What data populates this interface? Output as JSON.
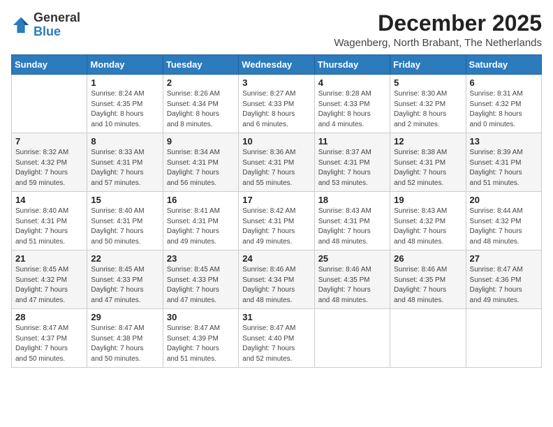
{
  "logo": {
    "general": "General",
    "blue": "Blue"
  },
  "title": "December 2025",
  "subtitle": "Wagenberg, North Brabant, The Netherlands",
  "days_of_week": [
    "Sunday",
    "Monday",
    "Tuesday",
    "Wednesday",
    "Thursday",
    "Friday",
    "Saturday"
  ],
  "weeks": [
    [
      {
        "day": "",
        "info": ""
      },
      {
        "day": "1",
        "info": "Sunrise: 8:24 AM\nSunset: 4:35 PM\nDaylight: 8 hours\nand 10 minutes."
      },
      {
        "day": "2",
        "info": "Sunrise: 8:26 AM\nSunset: 4:34 PM\nDaylight: 8 hours\nand 8 minutes."
      },
      {
        "day": "3",
        "info": "Sunrise: 8:27 AM\nSunset: 4:33 PM\nDaylight: 8 hours\nand 6 minutes."
      },
      {
        "day": "4",
        "info": "Sunrise: 8:28 AM\nSunset: 4:33 PM\nDaylight: 8 hours\nand 4 minutes."
      },
      {
        "day": "5",
        "info": "Sunrise: 8:30 AM\nSunset: 4:32 PM\nDaylight: 8 hours\nand 2 minutes."
      },
      {
        "day": "6",
        "info": "Sunrise: 8:31 AM\nSunset: 4:32 PM\nDaylight: 8 hours\nand 0 minutes."
      }
    ],
    [
      {
        "day": "7",
        "info": "Sunrise: 8:32 AM\nSunset: 4:32 PM\nDaylight: 7 hours\nand 59 minutes."
      },
      {
        "day": "8",
        "info": "Sunrise: 8:33 AM\nSunset: 4:31 PM\nDaylight: 7 hours\nand 57 minutes."
      },
      {
        "day": "9",
        "info": "Sunrise: 8:34 AM\nSunset: 4:31 PM\nDaylight: 7 hours\nand 56 minutes."
      },
      {
        "day": "10",
        "info": "Sunrise: 8:36 AM\nSunset: 4:31 PM\nDaylight: 7 hours\nand 55 minutes."
      },
      {
        "day": "11",
        "info": "Sunrise: 8:37 AM\nSunset: 4:31 PM\nDaylight: 7 hours\nand 53 minutes."
      },
      {
        "day": "12",
        "info": "Sunrise: 8:38 AM\nSunset: 4:31 PM\nDaylight: 7 hours\nand 52 minutes."
      },
      {
        "day": "13",
        "info": "Sunrise: 8:39 AM\nSunset: 4:31 PM\nDaylight: 7 hours\nand 51 minutes."
      }
    ],
    [
      {
        "day": "14",
        "info": "Sunrise: 8:40 AM\nSunset: 4:31 PM\nDaylight: 7 hours\nand 51 minutes."
      },
      {
        "day": "15",
        "info": "Sunrise: 8:40 AM\nSunset: 4:31 PM\nDaylight: 7 hours\nand 50 minutes."
      },
      {
        "day": "16",
        "info": "Sunrise: 8:41 AM\nSunset: 4:31 PM\nDaylight: 7 hours\nand 49 minutes."
      },
      {
        "day": "17",
        "info": "Sunrise: 8:42 AM\nSunset: 4:31 PM\nDaylight: 7 hours\nand 49 minutes."
      },
      {
        "day": "18",
        "info": "Sunrise: 8:43 AM\nSunset: 4:31 PM\nDaylight: 7 hours\nand 48 minutes."
      },
      {
        "day": "19",
        "info": "Sunrise: 8:43 AM\nSunset: 4:32 PM\nDaylight: 7 hours\nand 48 minutes."
      },
      {
        "day": "20",
        "info": "Sunrise: 8:44 AM\nSunset: 4:32 PM\nDaylight: 7 hours\nand 48 minutes."
      }
    ],
    [
      {
        "day": "21",
        "info": "Sunrise: 8:45 AM\nSunset: 4:32 PM\nDaylight: 7 hours\nand 47 minutes."
      },
      {
        "day": "22",
        "info": "Sunrise: 8:45 AM\nSunset: 4:33 PM\nDaylight: 7 hours\nand 47 minutes."
      },
      {
        "day": "23",
        "info": "Sunrise: 8:45 AM\nSunset: 4:33 PM\nDaylight: 7 hours\nand 47 minutes."
      },
      {
        "day": "24",
        "info": "Sunrise: 8:46 AM\nSunset: 4:34 PM\nDaylight: 7 hours\nand 48 minutes."
      },
      {
        "day": "25",
        "info": "Sunrise: 8:46 AM\nSunset: 4:35 PM\nDaylight: 7 hours\nand 48 minutes."
      },
      {
        "day": "26",
        "info": "Sunrise: 8:46 AM\nSunset: 4:35 PM\nDaylight: 7 hours\nand 48 minutes."
      },
      {
        "day": "27",
        "info": "Sunrise: 8:47 AM\nSunset: 4:36 PM\nDaylight: 7 hours\nand 49 minutes."
      }
    ],
    [
      {
        "day": "28",
        "info": "Sunrise: 8:47 AM\nSunset: 4:37 PM\nDaylight: 7 hours\nand 50 minutes."
      },
      {
        "day": "29",
        "info": "Sunrise: 8:47 AM\nSunset: 4:38 PM\nDaylight: 7 hours\nand 50 minutes."
      },
      {
        "day": "30",
        "info": "Sunrise: 8:47 AM\nSunset: 4:39 PM\nDaylight: 7 hours\nand 51 minutes."
      },
      {
        "day": "31",
        "info": "Sunrise: 8:47 AM\nSunset: 4:40 PM\nDaylight: 7 hours\nand 52 minutes."
      },
      {
        "day": "",
        "info": ""
      },
      {
        "day": "",
        "info": ""
      },
      {
        "day": "",
        "info": ""
      }
    ]
  ]
}
